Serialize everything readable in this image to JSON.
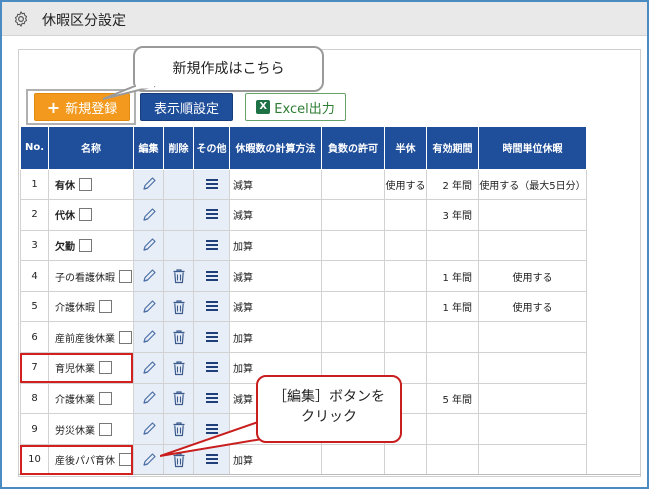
{
  "header": {
    "title": "休暇区分設定",
    "icon": "gear-icon"
  },
  "toolbar": {
    "new_label": "新規登録",
    "new_plus": "+",
    "order_label": "表示順設定",
    "excel_icon_text": "X",
    "excel_label": "Excel出力"
  },
  "callouts": {
    "new_hint": "新規作成はこちら",
    "edit_hint_line1": "［編集］ボタンを",
    "edit_hint_line2": "クリック"
  },
  "colors": {
    "accent_orange": "#f39a1e",
    "header_blue": "#1f4e9a",
    "highlight_red": "#d21f1f"
  },
  "table": {
    "columns": [
      "No.",
      "名称",
      "編集",
      "削除",
      "その他",
      "休暇数の計算方法",
      "負数の許可",
      "半休",
      "有効期間",
      "時間単位休暇"
    ],
    "rows": [
      {
        "no": "1",
        "name": "有休",
        "bold": true,
        "deletable": false,
        "calc": "減算",
        "negative": "",
        "half": "使用する",
        "period": "2 年間",
        "hourly": "使用する（最大5日分）"
      },
      {
        "no": "2",
        "name": "代休",
        "bold": true,
        "deletable": false,
        "calc": "減算",
        "negative": "",
        "half": "",
        "period": "3 年間",
        "hourly": ""
      },
      {
        "no": "3",
        "name": "欠勤",
        "bold": true,
        "deletable": false,
        "calc": "加算",
        "negative": "",
        "half": "",
        "period": "",
        "hourly": ""
      },
      {
        "no": "4",
        "name": "子の看護休暇",
        "bold": false,
        "deletable": true,
        "calc": "減算",
        "negative": "",
        "half": "",
        "period": "1 年間",
        "hourly": "使用する"
      },
      {
        "no": "5",
        "name": "介護休暇",
        "bold": false,
        "deletable": true,
        "calc": "減算",
        "negative": "",
        "half": "",
        "period": "1 年間",
        "hourly": "使用する"
      },
      {
        "no": "6",
        "name": "産前産後休業",
        "bold": false,
        "deletable": true,
        "calc": "加算",
        "negative": "",
        "half": "",
        "period": "",
        "hourly": ""
      },
      {
        "no": "7",
        "name": "育児休業",
        "bold": false,
        "deletable": true,
        "calc": "加算",
        "negative": "",
        "half": "",
        "period": "",
        "hourly": ""
      },
      {
        "no": "8",
        "name": "介護休業",
        "bold": false,
        "deletable": true,
        "calc": "減算",
        "negative": "",
        "half": "",
        "period": "5 年間",
        "hourly": ""
      },
      {
        "no": "9",
        "name": "労災休業",
        "bold": false,
        "deletable": true,
        "calc": "",
        "negative": "",
        "half": "",
        "period": "",
        "hourly": ""
      },
      {
        "no": "10",
        "name": "産後パパ育休",
        "bold": false,
        "deletable": true,
        "calc": "加算",
        "negative": "",
        "half": "",
        "period": "",
        "hourly": ""
      }
    ]
  }
}
